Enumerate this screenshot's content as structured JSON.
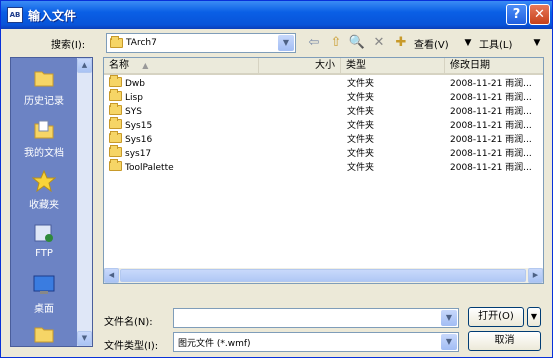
{
  "window": {
    "title": "输入文件",
    "app_icon_text": "AB"
  },
  "titlebar": {
    "help": "?",
    "close": "✕"
  },
  "lookin": {
    "label": "搜索(I):",
    "value": "TArch7"
  },
  "toolbar": {
    "view_label": "查看(V)",
    "tools_label": "工具(L)"
  },
  "places": [
    {
      "label": "历史记录",
      "icon": "history-icon"
    },
    {
      "label": "我的文档",
      "icon": "my-documents-icon"
    },
    {
      "label": "收藏夹",
      "icon": "favorites-icon"
    },
    {
      "label": "FTP",
      "icon": "ftp-icon"
    },
    {
      "label": "桌面",
      "icon": "desktop-icon"
    }
  ],
  "list": {
    "columns": [
      "名称",
      "大小",
      "类型",
      "修改日期"
    ],
    "rows": [
      {
        "name": "Dwb",
        "size": "",
        "type": "文件夹",
        "date": "2008-11-21 雨润..."
      },
      {
        "name": "Lisp",
        "size": "",
        "type": "文件夹",
        "date": "2008-11-21 雨润..."
      },
      {
        "name": "SYS",
        "size": "",
        "type": "文件夹",
        "date": "2008-11-21 雨润..."
      },
      {
        "name": "Sys15",
        "size": "",
        "type": "文件夹",
        "date": "2008-11-21 雨润..."
      },
      {
        "name": "Sys16",
        "size": "",
        "type": "文件夹",
        "date": "2008-11-21 雨润..."
      },
      {
        "name": "sys17",
        "size": "",
        "type": "文件夹",
        "date": "2008-11-21 雨润..."
      },
      {
        "name": "ToolPalette",
        "size": "",
        "type": "文件夹",
        "date": "2008-11-21 雨润..."
      }
    ]
  },
  "filename": {
    "label": "文件名(N):",
    "value": ""
  },
  "filetype": {
    "label": "文件类型(I):",
    "value": "图元文件 (*.wmf)"
  },
  "buttons": {
    "open": "打开(O)",
    "cancel": "取消"
  }
}
